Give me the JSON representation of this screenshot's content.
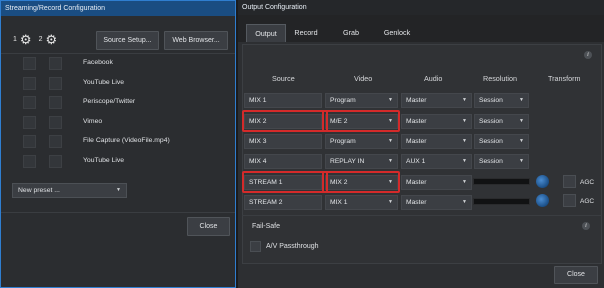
{
  "left_panel": {
    "title": "Streaming/Record Configuration",
    "gear_1_label": "1",
    "gear_2_label": "2",
    "source_setup_label": "Source Setup...",
    "web_browser_label": "Web Browser...",
    "sources": [
      "Facebook",
      "YouTube Live",
      "Periscope/Twitter",
      "Vimeo",
      "File Capture (VideoFile.mp4)",
      "YouTube Live"
    ],
    "preset_value": "New preset ...",
    "close_label": "Close"
  },
  "right_panel": {
    "title": "Output Configuration",
    "tabs": [
      "Output",
      "Record",
      "Grab",
      "Genlock"
    ],
    "active_tab": "Output",
    "columns": {
      "source": "Source",
      "video": "Video",
      "audio": "Audio",
      "resolution": "Resolution",
      "transform": "Transform"
    },
    "rows": [
      {
        "source": "MIX 1",
        "video": "Program",
        "audio": "Master",
        "resolution": "Session"
      },
      {
        "source": "MIX 2",
        "video": "M/E 2",
        "audio": "Master",
        "resolution": "Session"
      },
      {
        "source": "MIX 3",
        "video": "Program",
        "audio": "Master",
        "resolution": "Session"
      },
      {
        "source": "MIX 4",
        "video": "REPLAY IN",
        "audio": "AUX 1",
        "resolution": "Session"
      },
      {
        "source": "STREAM 1",
        "video": "MIX 2",
        "audio": "Master",
        "agc": "AGC"
      },
      {
        "source": "STREAM 2",
        "video": "MIX 1",
        "audio": "Master",
        "agc": "AGC"
      }
    ],
    "failsafe_label": "Fail-Safe",
    "av_passthrough_label": "A/V Passthrough",
    "close_label": "Close",
    "highlight_color": "#d42a2a"
  },
  "icons": {
    "gear": "gear-icon",
    "info": "info-icon",
    "dropdown": "chevron-down-icon"
  }
}
